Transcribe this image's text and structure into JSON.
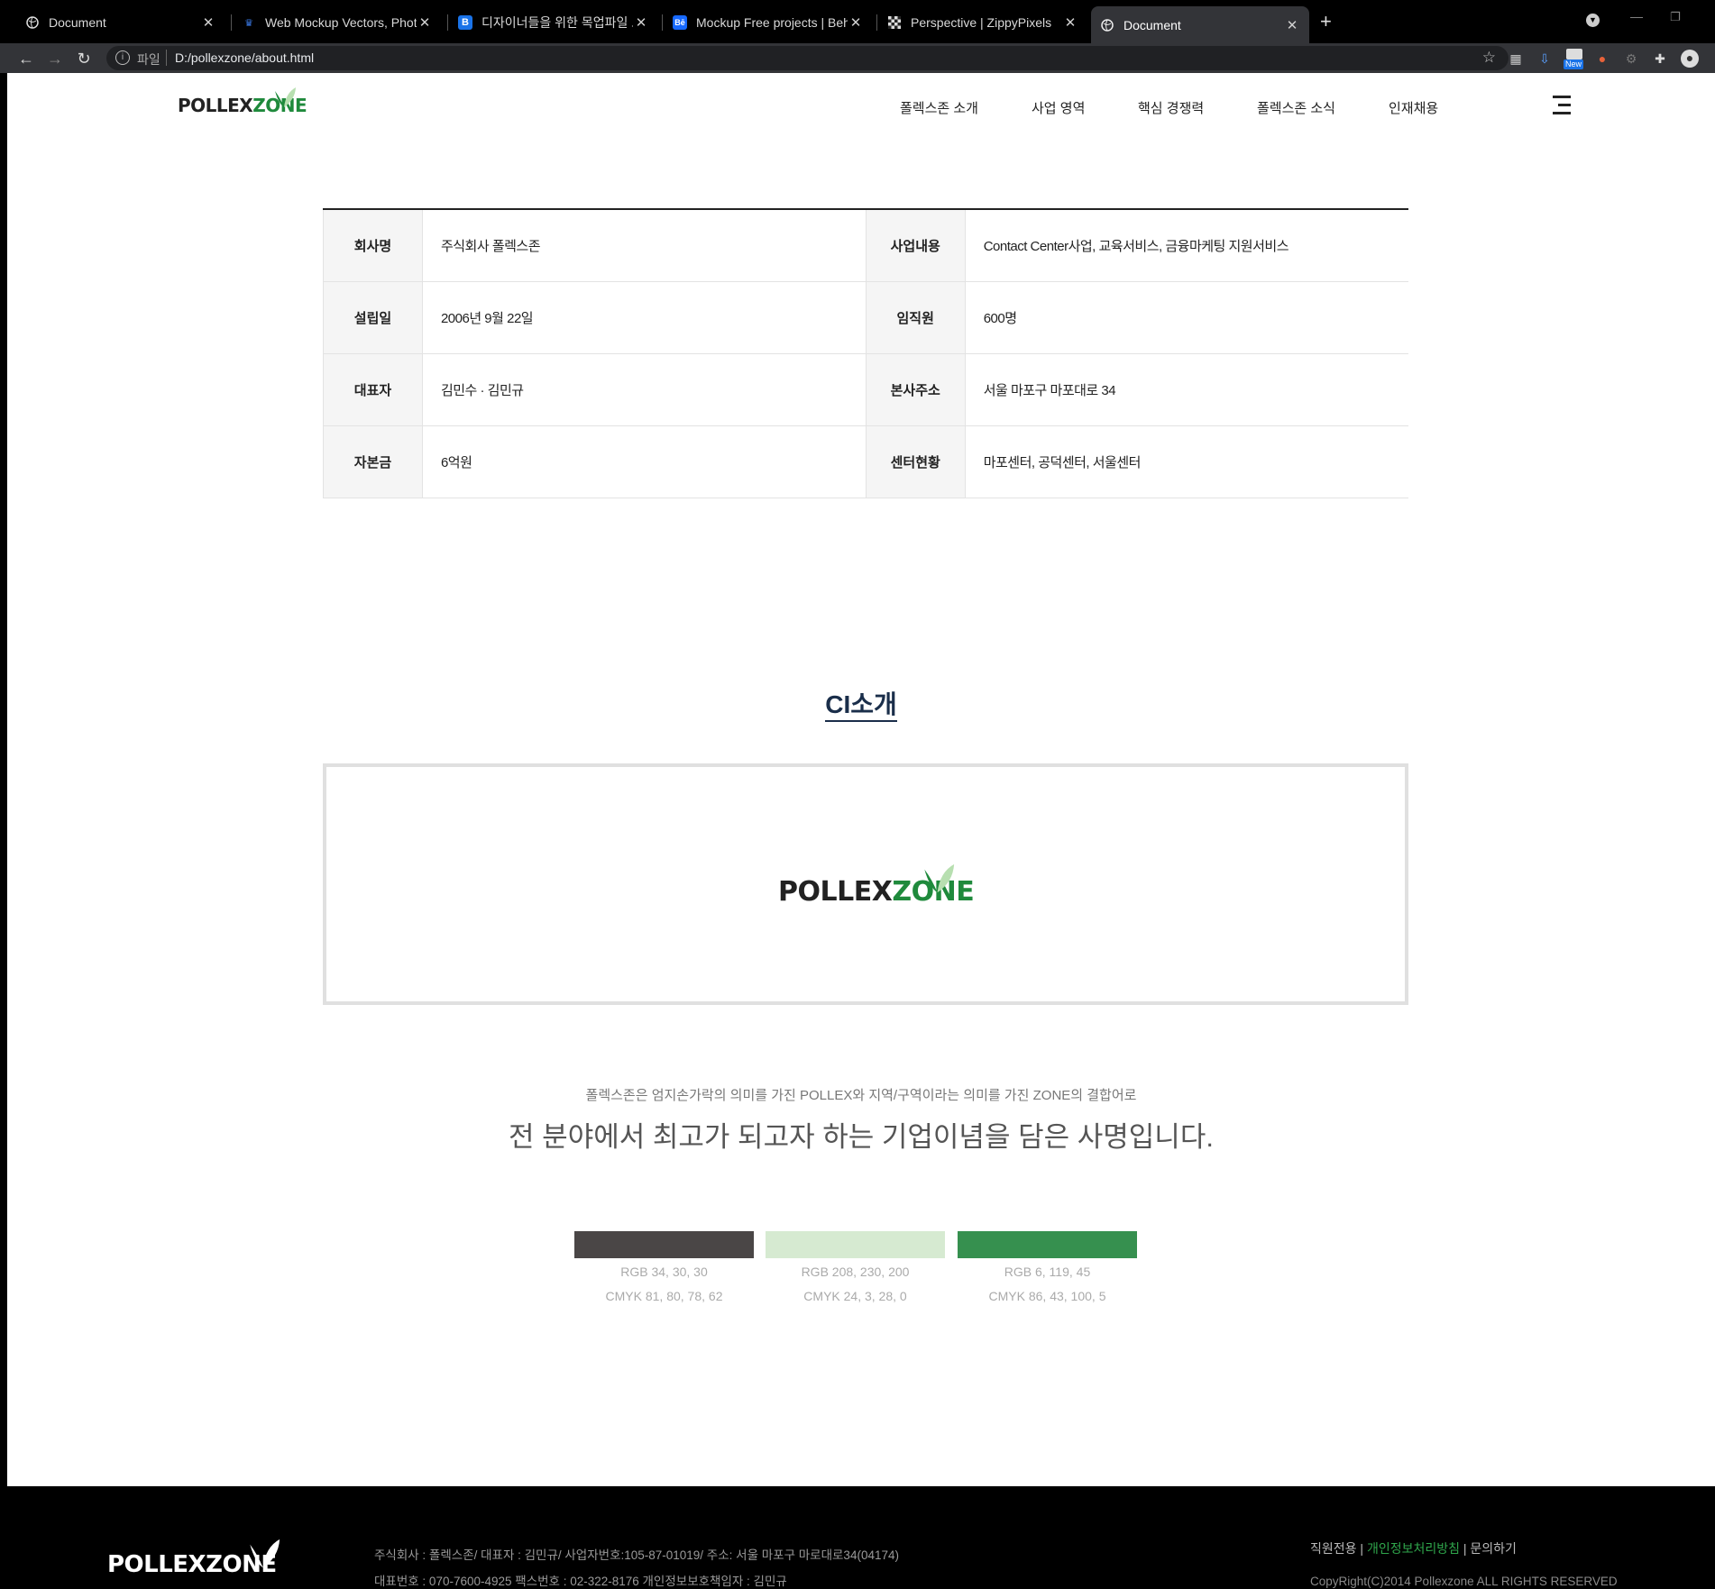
{
  "browser": {
    "tabs": [
      {
        "title": "Document",
        "icon": "globe-icon"
      },
      {
        "title": "Web Mockup Vectors, Photos a",
        "icon": "freepik-icon"
      },
      {
        "title": "디자이너들을 위한 목업파일 모음",
        "icon": "b-icon"
      },
      {
        "title": "Mockup Free projects | Behance",
        "icon": "behance-icon"
      },
      {
        "title": "Perspective | ZippyPixels",
        "icon": "checker-icon"
      },
      {
        "title": "Document",
        "icon": "globe-icon",
        "active": true
      }
    ],
    "address": {
      "scheme": "파일",
      "url": "D:/pollexzone/about.html"
    },
    "badge": "New"
  },
  "site": {
    "logo": {
      "dark": "POLLEX",
      "green": "ZONE"
    },
    "nav": [
      "폴렉스존 소개",
      "사업 영역",
      "핵심 경쟁력",
      "폴렉스존 소식",
      "인재채용"
    ]
  },
  "company_info": [
    [
      {
        "label": "회사명",
        "value": "주식회사 폴렉스존"
      },
      {
        "label": "사업내용",
        "value": "Contact Center사업, 교육서비스, 금융마케팅 지원서비스"
      }
    ],
    [
      {
        "label": "설립일",
        "value": "2006년 9월 22일"
      },
      {
        "label": "임직원",
        "value": "600명"
      }
    ],
    [
      {
        "label": "대표자",
        "value": "김민수 · 김민규"
      },
      {
        "label": "본사주소",
        "value": "서울 마포구 마포대로 34"
      }
    ],
    [
      {
        "label": "자본금",
        "value": "6억원"
      },
      {
        "label": "센터현황",
        "value": "마포센터, 공덕센터, 서울센터"
      }
    ]
  ],
  "ci": {
    "title": "CI소개",
    "desc_small": "폴렉스존은 엄지손가락의 의미를 가진 POLLEX와 지역/구역이라는 의미를 가진 ZONE의 결합어로",
    "desc_big": "전 분야에서 최고가 되고자 하는 기업이념을 담은 사명입니다.",
    "colors": [
      {
        "hex": "#4a4646",
        "rgb": "RGB 34, 30, 30",
        "cmyk": "CMYK 81, 80, 78, 62"
      },
      {
        "hex": "#d6ead1",
        "rgb": "RGB 208, 230, 200",
        "cmyk": "CMYK 24, 3, 28, 0"
      },
      {
        "hex": "#36904f",
        "rgb": "RGB 6, 119, 45",
        "cmyk": "CMYK 86, 43, 100, 5"
      }
    ]
  },
  "footer": {
    "line1": "주식회사 : 폴렉스존/ 대표자 : 김민규/ 사업자번호:105-87-01019/ 주소: 서울 마포구 마로대로34(04174)",
    "line2": "대표번호 : 070-7600-4925 팩스번호 : 02-322-8176 개인정보보호책임자 : 김민규",
    "link_staff": "직원전용",
    "link_privacy": "개인정보처리방침",
    "link_contact": "문의하기",
    "separator": "|",
    "copyright": "CopyRight(C)2014 Pollexzone ALL RIGHTS RESERVED"
  }
}
